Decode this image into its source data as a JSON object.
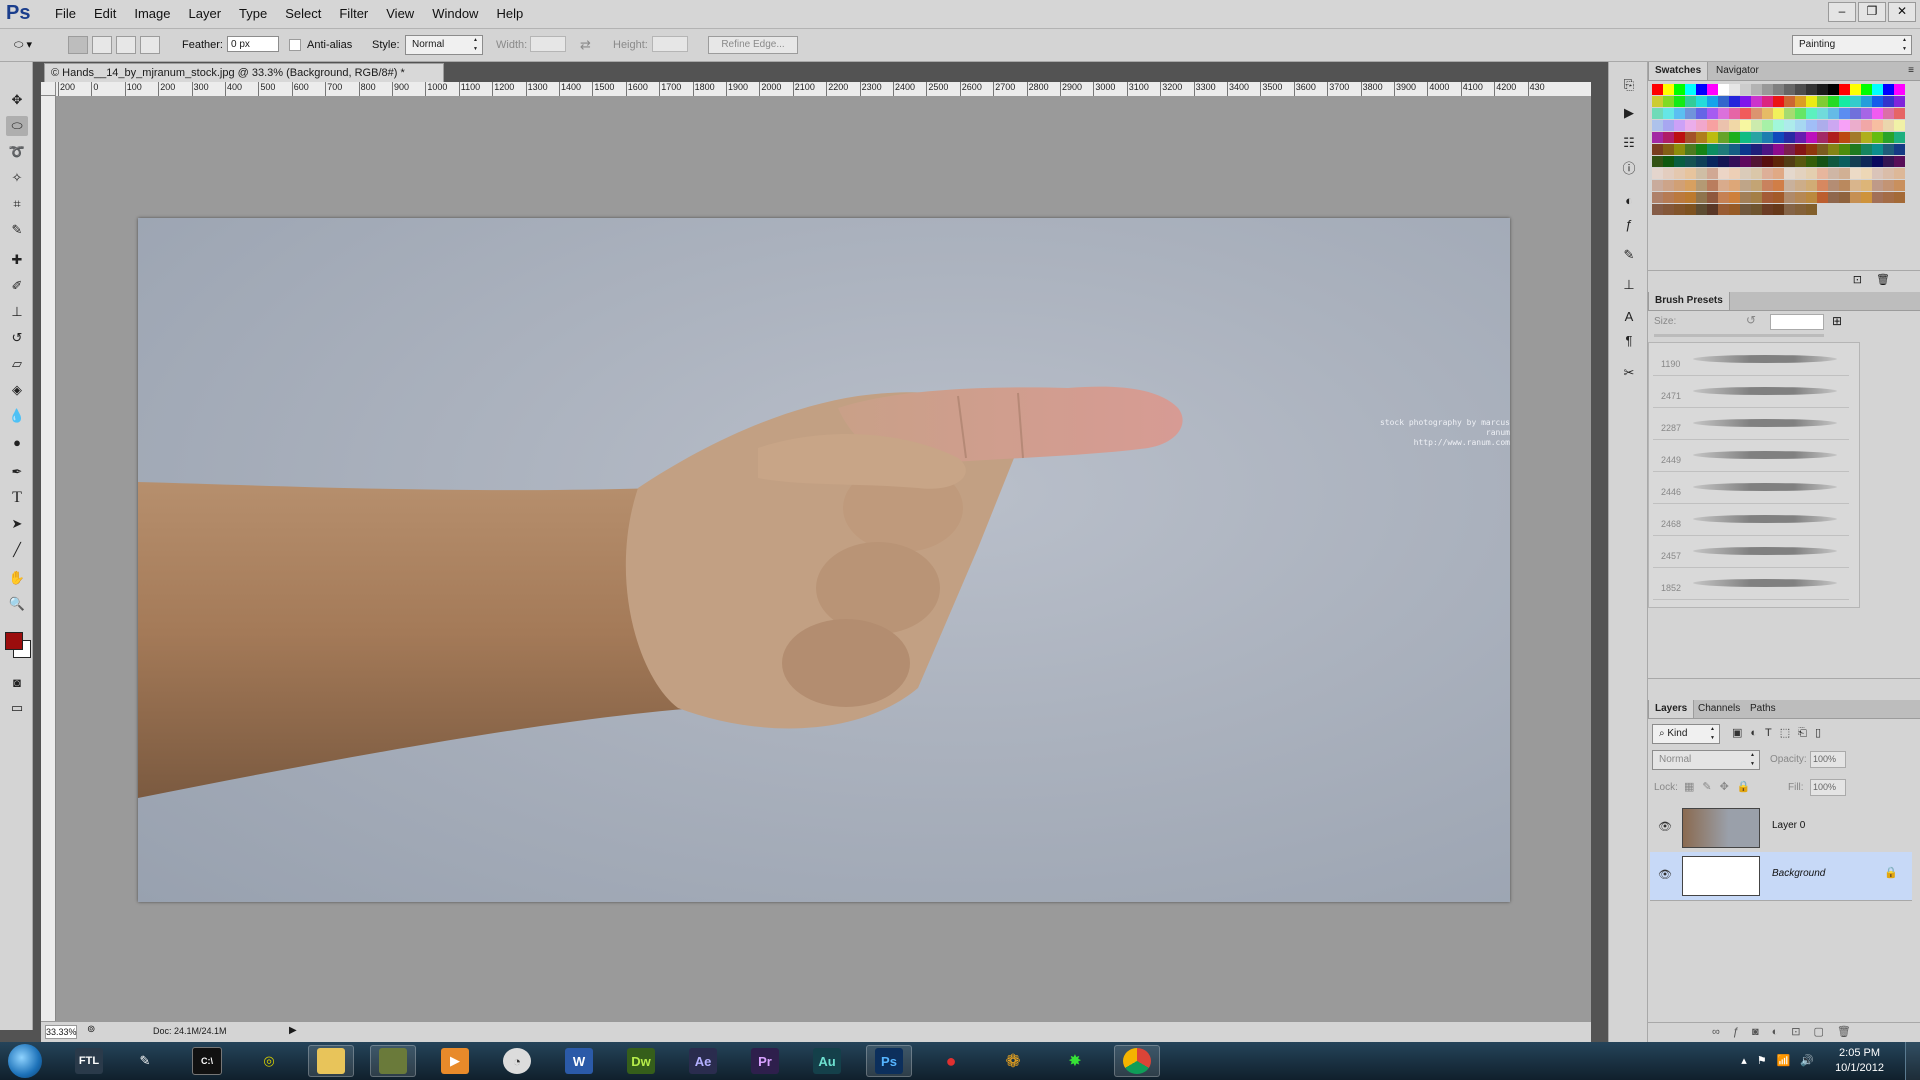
{
  "app": {
    "logo": "Ps"
  },
  "menu": [
    "File",
    "Edit",
    "Image",
    "Layer",
    "Type",
    "Select",
    "Filter",
    "View",
    "Window",
    "Help"
  ],
  "window_controls": [
    "–",
    "❐",
    "✕"
  ],
  "options": {
    "feather_label": "Feather:",
    "feather_value": "0 px",
    "antialias_label": "Anti-alias",
    "style_label": "Style:",
    "style_value": "Normal",
    "width_label": "Width:",
    "height_label": "Height:",
    "refine_edge": "Refine Edge...",
    "workspace": "Painting"
  },
  "document": {
    "tab_title": "© Hands__14_by_mjranum_stock.jpg @ 33.3% (Background, RGB/8#) *",
    "watermark_line1": "stock photography by marcus ranum",
    "watermark_line2": "http://www.ranum.com",
    "zoom": "33.33%",
    "doc_info": "Doc: 24.1M/24.1M"
  },
  "ruler_labels": [
    "200",
    "0",
    "100",
    "200",
    "300",
    "400",
    "500",
    "600",
    "700",
    "800",
    "900",
    "1000",
    "1100",
    "1200",
    "1300",
    "1400",
    "1500",
    "1600",
    "1700",
    "1800",
    "1900",
    "2000",
    "2100",
    "2200",
    "2300",
    "2400",
    "2500",
    "2600",
    "2700",
    "2800",
    "2900",
    "3000",
    "3100",
    "3200",
    "3300",
    "3400",
    "3500",
    "3600",
    "3700",
    "3800",
    "3900",
    "4000",
    "4100",
    "4200",
    "430"
  ],
  "panels": {
    "swatches_tab": "Swatches",
    "navigator_tab": "Navigator",
    "brush_presets_tab": "Brush Presets",
    "size_label": "Size:",
    "brush_sizes": [
      "1190",
      "2471",
      "2287",
      "2449",
      "2446",
      "2468",
      "2457",
      "1852"
    ],
    "layers_tab": "Layers",
    "channels_tab": "Channels",
    "paths_tab": "Paths",
    "kind_label": "Kind",
    "blend_mode": "Normal",
    "opacity_label": "Opacity:",
    "opacity_value": "100%",
    "lock_label": "Lock:",
    "fill_label": "Fill:",
    "fill_value": "100%",
    "layers": [
      {
        "name": "Layer 0"
      },
      {
        "name": "Background"
      }
    ]
  },
  "colors": {
    "foreground": "#9b0d0d",
    "background": "#ffffff",
    "accent_selected": "#c7d9f7"
  },
  "taskbar": {
    "apps": [
      "FTL",
      "",
      "",
      "",
      "",
      "",
      "",
      "",
      "W",
      "Dw",
      "Ae",
      "Pr",
      "Au",
      "Ps",
      "",
      "",
      "",
      ""
    ],
    "clock_time": "2:05 PM",
    "clock_date": "10/1/2012"
  }
}
